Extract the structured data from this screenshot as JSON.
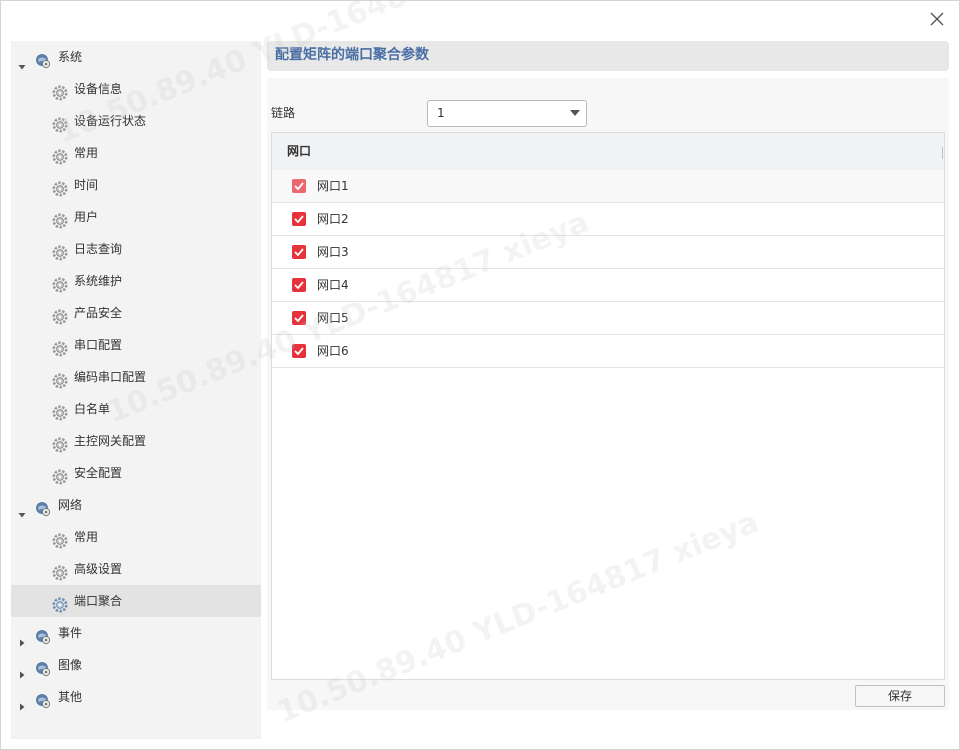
{
  "sidebar": {
    "groups": [
      {
        "label": "系统",
        "expanded": true,
        "children": [
          {
            "label": "设备信息"
          },
          {
            "label": "设备运行状态"
          },
          {
            "label": "常用"
          },
          {
            "label": "时间"
          },
          {
            "label": "用户"
          },
          {
            "label": "日志查询"
          },
          {
            "label": "系统维护"
          },
          {
            "label": "产品安全"
          },
          {
            "label": "串口配置"
          },
          {
            "label": "编码串口配置"
          },
          {
            "label": "白名单"
          },
          {
            "label": "主控网关配置"
          },
          {
            "label": "安全配置"
          }
        ]
      },
      {
        "label": "网络",
        "expanded": true,
        "children": [
          {
            "label": "常用"
          },
          {
            "label": "高级设置"
          },
          {
            "label": "端口聚合",
            "selected": true
          }
        ]
      },
      {
        "label": "事件",
        "expanded": false,
        "children": []
      },
      {
        "label": "图像",
        "expanded": false,
        "children": []
      },
      {
        "label": "其他",
        "expanded": false,
        "children": []
      }
    ]
  },
  "panel": {
    "title": "配置矩阵的端口聚合参数",
    "link_label": "链路",
    "link_value": "1"
  },
  "table": {
    "header": "网口",
    "rows": [
      {
        "label": "网口1",
        "checked": true
      },
      {
        "label": "网口2",
        "checked": true
      },
      {
        "label": "网口3",
        "checked": true
      },
      {
        "label": "网口4",
        "checked": true
      },
      {
        "label": "网口5",
        "checked": true
      },
      {
        "label": "网口6",
        "checked": true
      }
    ]
  },
  "actions": {
    "save_label": "保存"
  },
  "watermark": {
    "text": "10.50.89.40  YLD-164817  xieya"
  },
  "colors": {
    "accent_title": "#4a6fa5",
    "checkbox": "#e5323b",
    "selected_row": "#e3e3e3",
    "sidebar_bg": "#f3f3f3"
  }
}
